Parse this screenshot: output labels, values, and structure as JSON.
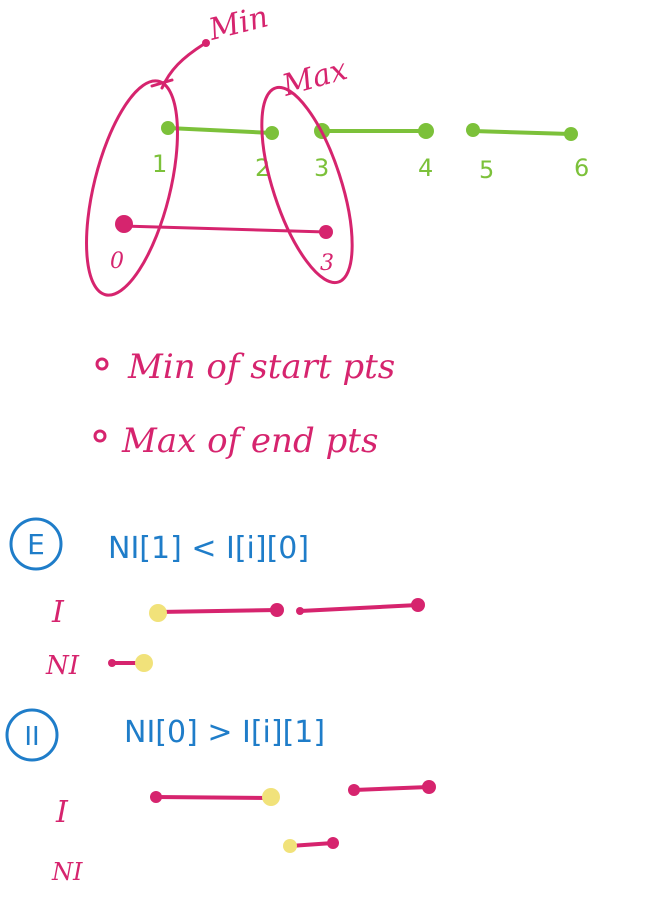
{
  "top": {
    "min_label": "Min",
    "max_label": "Max",
    "green_labels": [
      "1",
      "2",
      "3",
      "4",
      "5",
      "6"
    ],
    "pink_labels": [
      "0",
      "3"
    ]
  },
  "notes": {
    "line1": "Min of start pts",
    "line2": "Max of end pts"
  },
  "case1": {
    "badge": "E",
    "condition": "NI[1] < I[i][0]",
    "row_i_label": "I",
    "row_ni_label": "NI"
  },
  "case2": {
    "badge": "II",
    "condition": "NI[0] > I[i][1]",
    "row_i_label": "I",
    "row_ni_label": "NI"
  },
  "colors": {
    "pink": "#d6246e",
    "green": "#7cc13a",
    "blue": "#1f7dc9",
    "yellow": "#f1e27a"
  }
}
